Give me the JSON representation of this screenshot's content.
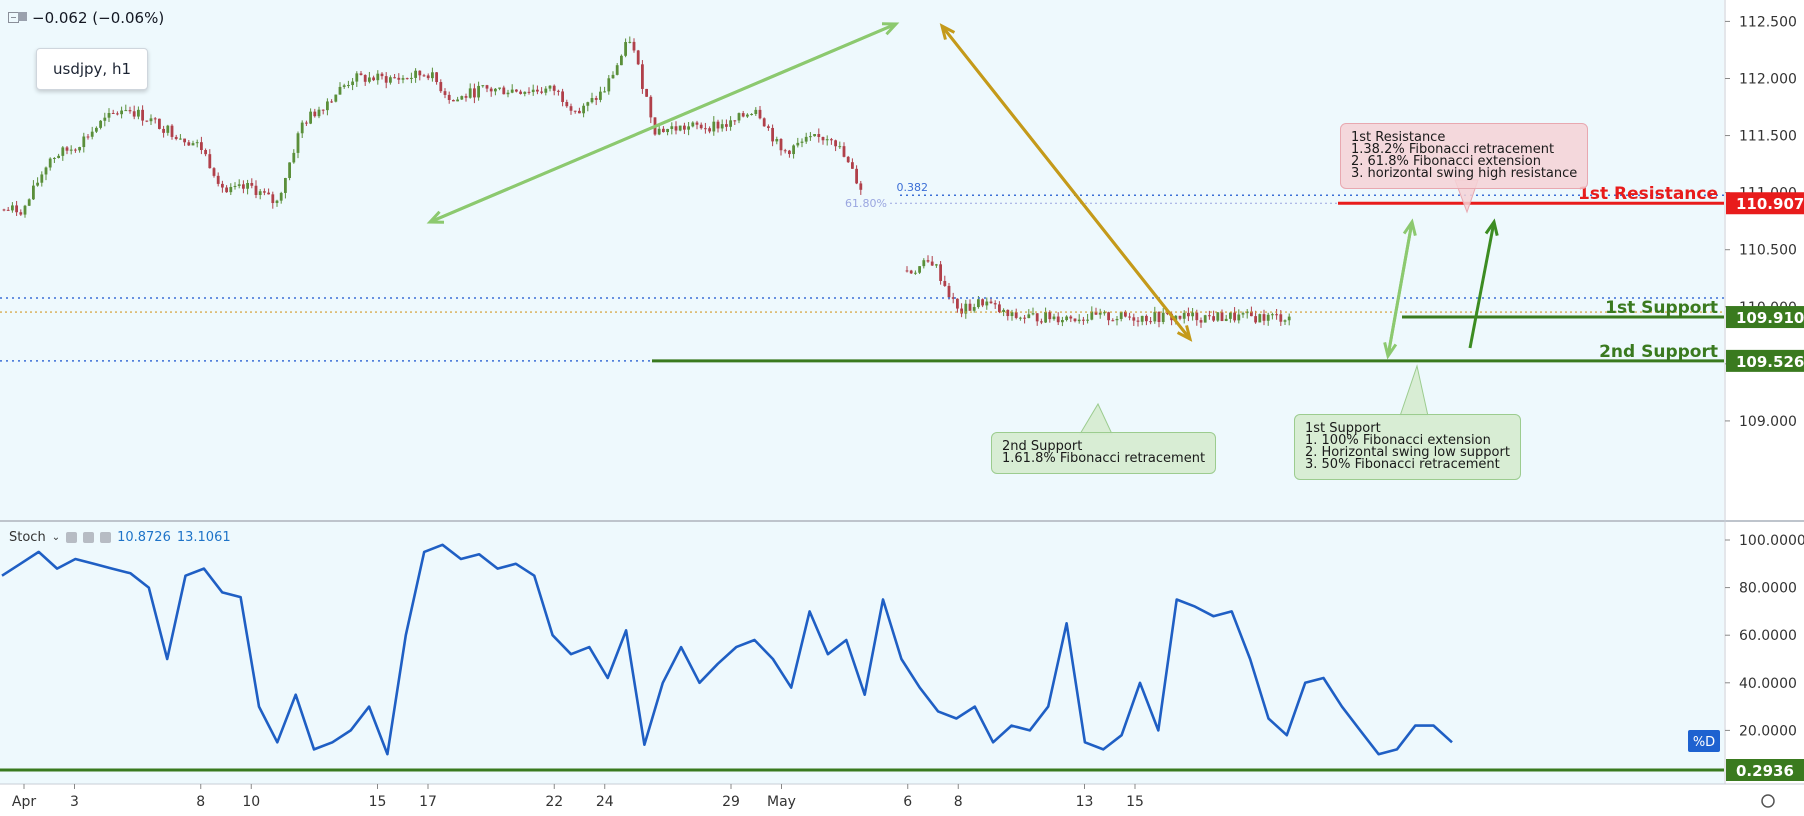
{
  "header": {
    "change": "−0.062 (−0.06%)",
    "symbol": "usdjpy, h1"
  },
  "stoch": {
    "name": "Stoch",
    "value1": "10.8726",
    "value2": "13.1061",
    "series_label": "%D"
  },
  "notes": {
    "resistance": "1st Resistance\n1.38.2% Fibonacci retracement\n2. 61.8% Fibonacci extension\n3. horizontal swing high resistance",
    "support1": "1st Support\n1. 100% Fibonacci extension\n2. Horizontal swing low support\n3. 50% Fibonacci retracement",
    "support2": "2nd Support\n1.61.8% Fibonacci retracement"
  },
  "colors": {
    "background": "#eef9fd",
    "candle_up": "#5a8f3a",
    "candle_down": "#b0404a",
    "stoch_line": "#1f5fc4",
    "resistance": "#e81c1c",
    "support": "#3a7a1f",
    "dotted_blue": "#3c6fd6",
    "arrow_light_green": "#8cc96f",
    "arrow_dark_green": "#3c8c22",
    "arrow_gold": "#c49a1a"
  },
  "chart_data": [
    {
      "type": "candlestick",
      "title": "usdjpy, h1",
      "x_ticks": [
        "Apr",
        "3",
        "8",
        "10",
        "15",
        "17",
        "22",
        "24",
        "29",
        "May",
        "6",
        "8",
        "13",
        "15"
      ],
      "y_ticks": [
        "112.500",
        "112.000",
        "111.500",
        "111.000",
        "110.500",
        "110.000",
        "109.500",
        "109.000"
      ],
      "ylim": [
        108.57,
        112.6
      ],
      "close_path": [
        [
          "Apr 1",
          110.85
        ],
        [
          "Apr 2",
          111.3
        ],
        [
          "Apr 3",
          111.4
        ],
        [
          "Apr 4",
          111.6
        ],
        [
          "Apr 5",
          111.75
        ],
        [
          "Apr 8",
          111.4
        ],
        [
          "Apr 9",
          111.0
        ],
        [
          "Apr 10",
          111.05
        ],
        [
          "Apr 11",
          110.9
        ],
        [
          "Apr 12",
          111.6
        ],
        [
          "Apr 14",
          112.0
        ],
        [
          "Apr 16",
          112.0
        ],
        [
          "Apr 17",
          112.05
        ],
        [
          "Apr 18",
          111.8
        ],
        [
          "Apr 19",
          111.9
        ],
        [
          "Apr 22",
          111.9
        ],
        [
          "Apr 23",
          111.7
        ],
        [
          "Apr 24",
          111.9
        ],
        [
          "Apr 25",
          112.35
        ],
        [
          "Apr 26",
          111.55
        ],
        [
          "Apr 29",
          111.6
        ],
        [
          "Apr 30",
          111.75
        ],
        [
          "May 1",
          111.35
        ],
        [
          "May 2",
          111.45
        ],
        [
          "May 3",
          111.5
        ],
        [
          "May 6",
          110.3
        ],
        [
          "May 7",
          110.4
        ],
        [
          "May 8",
          109.95
        ],
        [
          "May 9",
          110.05
        ],
        [
          "May 10",
          109.91
        ]
      ],
      "levels": [
        {
          "name": "1st Resistance",
          "value": 110.907,
          "label": "110.907"
        },
        {
          "name": "1st Support",
          "value": 109.91,
          "label": "109.910"
        },
        {
          "name": "2nd Support",
          "value": 109.526,
          "label": "109.526"
        }
      ],
      "fib_labels": [
        "0.382",
        "61.80%"
      ],
      "level_labels": [
        "1st Resistance",
        "1st Support",
        "2nd Support"
      ]
    },
    {
      "type": "line",
      "title": "Stoch",
      "series_name": "%D",
      "y_ticks": [
        "100.0000",
        "80.0000",
        "60.0000",
        "40.0000",
        "20.0000"
      ],
      "ylim": [
        0,
        100
      ],
      "baseline_value": "0.2936",
      "values": [
        85,
        90,
        95,
        88,
        92,
        90,
        88,
        86,
        80,
        50,
        85,
        88,
        78,
        76,
        30,
        15,
        35,
        12,
        15,
        20,
        30,
        10,
        60,
        95,
        98,
        92,
        94,
        88,
        90,
        85,
        60,
        52,
        55,
        42,
        62,
        14,
        40,
        55,
        40,
        48,
        55,
        58,
        50,
        38,
        70,
        52,
        58,
        35,
        75,
        50,
        38,
        28,
        25,
        30,
        15,
        22,
        20,
        30,
        65,
        15,
        12,
        18,
        40,
        20,
        75,
        72,
        68,
        70,
        50,
        25,
        18,
        40,
        42,
        30,
        20,
        10,
        12,
        22,
        22,
        15
      ]
    }
  ]
}
